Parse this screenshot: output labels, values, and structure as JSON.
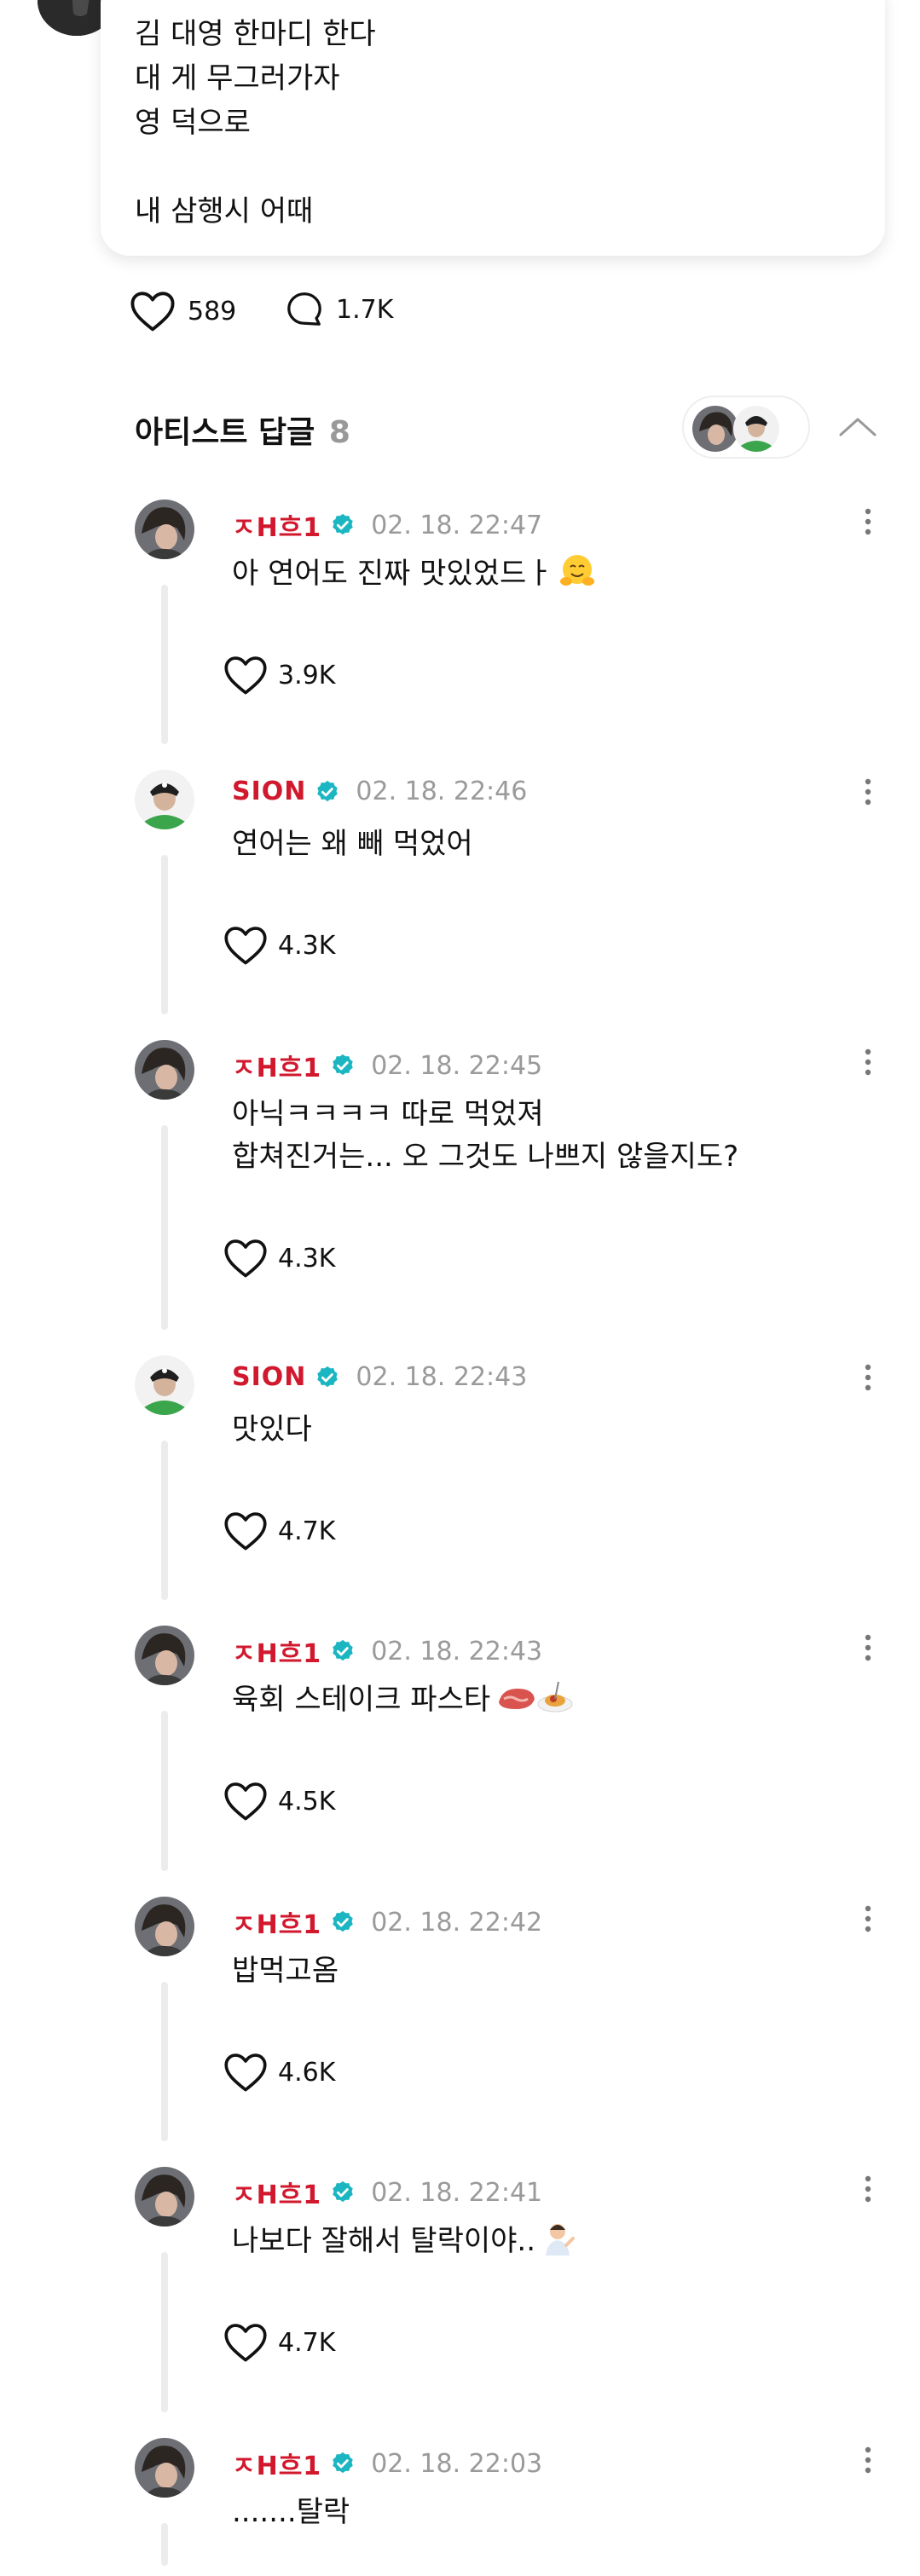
{
  "post": {
    "lines": [
      "김 대영 한마디 한다",
      "대 게 무그러가자",
      "영 덕으로",
      "",
      "내 삼행시 어때"
    ],
    "likes": "589",
    "comments": "1.7K"
  },
  "artist_replies": {
    "title": "아티스트 답글",
    "count": "8"
  },
  "colors": {
    "artist_name": "#d1182d",
    "verified": "#1bb6c1",
    "muted": "#9a9a9a"
  },
  "replies": [
    {
      "author": "ㅈH흐1",
      "avatar": "artist-a",
      "time": "02. 18. 22:47",
      "text": "아 연어도 진짜 맛있었드ㅏ",
      "emoji": "hugging-face-emoji",
      "likes": "3.9K"
    },
    {
      "author": "SION",
      "avatar": "artist-b",
      "time": "02. 18. 22:46",
      "text": "연어는 왜 빼 먹었어",
      "likes": "4.3K"
    },
    {
      "author": "ㅈH흐1",
      "avatar": "artist-a",
      "time": "02. 18. 22:45",
      "text": "아닉ㅋㅋㅋㅋ 따로 먹었져\n합쳐진거는... 오 그것도 나쁘지 않을지도?",
      "likes": "4.3K"
    },
    {
      "author": "SION",
      "avatar": "artist-b",
      "time": "02. 18. 22:43",
      "text": "맛있다",
      "likes": "4.7K"
    },
    {
      "author": "ㅈH흐1",
      "avatar": "artist-a",
      "time": "02. 18. 22:43",
      "text": "육회 스테이크 파스타",
      "emoji": "meat-spaghetti-emoji",
      "likes": "4.5K"
    },
    {
      "author": "ㅈH흐1",
      "avatar": "artist-a",
      "time": "02. 18. 22:42",
      "text": "밥먹고옴",
      "likes": "4.6K"
    },
    {
      "author": "ㅈH흐1",
      "avatar": "artist-a",
      "time": "02. 18. 22:41",
      "text": "나보다 잘해서 탈락이야..",
      "emoji": "person-tipping-hand-emoji",
      "likes": "4.7K"
    },
    {
      "author": "ㅈH흐1",
      "avatar": "artist-a",
      "time": "02. 18. 22:03",
      "text": ".......탈락"
    }
  ]
}
